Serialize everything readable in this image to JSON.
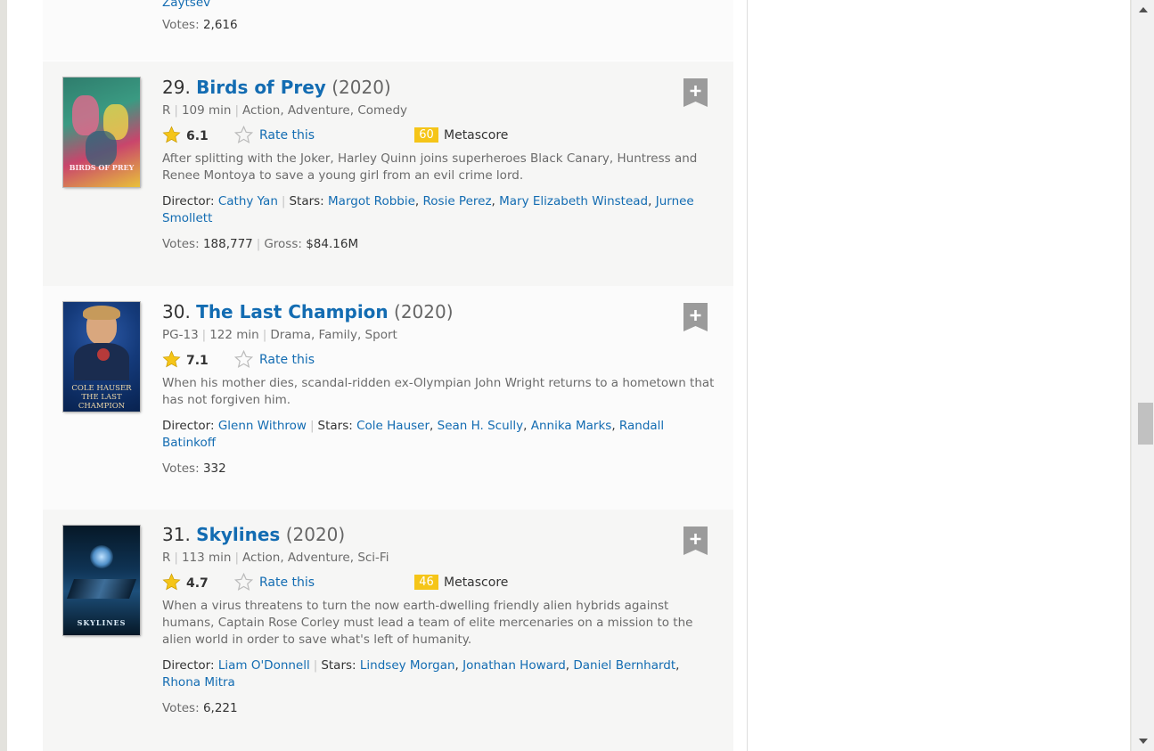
{
  "previous_item": {
    "director_tail": "Zaytsev",
    "votes_label": "Votes:",
    "votes": "2,616"
  },
  "items": [
    {
      "rank": "29.",
      "title": "Birds of Prey",
      "year": "(2020)",
      "certificate": "R",
      "runtime": "109 min",
      "genres": "Action, Adventure, Comedy",
      "rating": "6.1",
      "rate_label": "Rate this",
      "metascore": "60",
      "metascore_label": "Metascore",
      "plot": "After splitting with the Joker, Harley Quinn joins superheroes Black Canary, Huntress and Renee Montoya to save a young girl from an evil crime lord.",
      "director_label": "Director:",
      "director": "Cathy Yan",
      "stars_label": "Stars:",
      "stars": [
        "Margot Robbie",
        "Rosie Perez",
        "Mary Elizabeth Winstead",
        "Jurnee Smollett"
      ],
      "votes_label": "Votes:",
      "votes": "188,777",
      "gross_label": "Gross:",
      "gross": "$84.16M",
      "poster_text": "BIRDS OF PREY",
      "poster_colors": [
        "#2f7d6d",
        "#c9456c",
        "#e8c13a"
      ]
    },
    {
      "rank": "30.",
      "title": "The Last Champion",
      "year": "(2020)",
      "certificate": "PG-13",
      "runtime": "122 min",
      "genres": "Drama, Family, Sport",
      "rating": "7.1",
      "rate_label": "Rate this",
      "plot": "When his mother dies, scandal-ridden ex-Olympian John Wright returns to a hometown that has not forgiven him.",
      "director_label": "Director:",
      "director": "Glenn Withrow",
      "stars_label": "Stars:",
      "stars": [
        "Cole Hauser",
        "Sean H. Scully",
        "Annika Marks",
        "Randall Batinkoff"
      ],
      "votes_label": "Votes:",
      "votes": "332",
      "poster_text": "COLE HAUSER THE LAST CHAMPION",
      "poster_colors": [
        "#0d2e66",
        "#1d4a8f",
        "#c8a26a"
      ]
    },
    {
      "rank": "31.",
      "title": "Skylines",
      "year": "(2020)",
      "certificate": "R",
      "runtime": "113 min",
      "genres": "Action, Adventure, Sci-Fi",
      "rating": "4.7",
      "rate_label": "Rate this",
      "metascore": "46",
      "metascore_label": "Metascore",
      "plot": "When a virus threatens to turn the now earth-dwelling friendly alien hybrids against humans, Captain Rose Corley must lead a team of elite mercenaries on a mission to the alien world in order to save what's left of humanity.",
      "director_label": "Director:",
      "director": "Liam O'Donnell",
      "stars_label": "Stars:",
      "stars": [
        "Lindsey Morgan",
        "Jonathan Howard",
        "Daniel Bernhardt",
        "Rhona Mitra"
      ],
      "votes_label": "Votes:",
      "votes": "6,221",
      "poster_text": "SKYLINES",
      "poster_colors": [
        "#061827",
        "#1d4f7a",
        "#7fb6e0"
      ]
    }
  ],
  "colors": {
    "link": "#136cb2",
    "metascore_bg": "#f5c518",
    "star_gold": "#f5c518"
  }
}
